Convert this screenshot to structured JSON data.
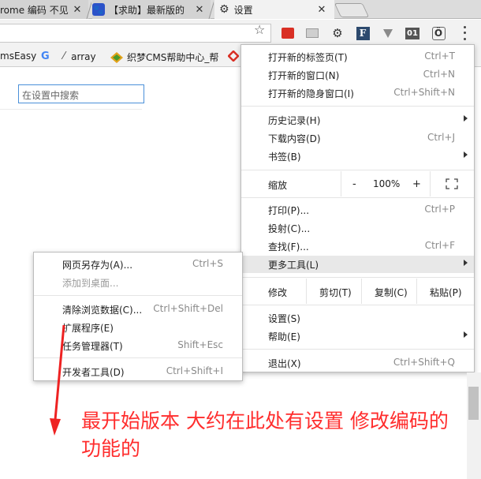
{
  "tabs": [
    {
      "title": "rome 编码 不见",
      "close": "✕"
    },
    {
      "title": "【求助】最新版的",
      "close": "✕"
    },
    {
      "title": "设置",
      "close": "✕"
    }
  ],
  "toolbar": {
    "star_icon": "☆",
    "ext_01": "01",
    "ext_f": "F",
    "ext_o": "Ö"
  },
  "bookmarks": [
    {
      "label": "msEasy"
    },
    {
      "label": "G"
    },
    {
      "label": "array"
    },
    {
      "label": "织梦CMS帮助中心_帮"
    }
  ],
  "search": {
    "placeholder": "在设置中搜索"
  },
  "menu": {
    "new_tab": {
      "label": "打开新的标签页(T)",
      "shortcut": "Ctrl+T"
    },
    "new_window": {
      "label": "打开新的窗口(N)",
      "shortcut": "Ctrl+N"
    },
    "incognito": {
      "label": "打开新的隐身窗口(I)",
      "shortcut": "Ctrl+Shift+N"
    },
    "history": {
      "label": "历史记录(H)"
    },
    "downloads": {
      "label": "下载内容(D)",
      "shortcut": "Ctrl+J"
    },
    "bookmarks": {
      "label": "书签(B)"
    },
    "zoom": {
      "label": "缩放",
      "minus": "-",
      "value": "100%",
      "plus": "+"
    },
    "print": {
      "label": "打印(P)...",
      "shortcut": "Ctrl+P"
    },
    "cast": {
      "label": "投射(C)..."
    },
    "find": {
      "label": "查找(F)...",
      "shortcut": "Ctrl+F"
    },
    "more_tools": {
      "label": "更多工具(L)"
    },
    "edit": {
      "label": "修改",
      "cut": "剪切(T)",
      "copy": "复制(C)",
      "paste": "粘贴(P)"
    },
    "settings": {
      "label": "设置(S)"
    },
    "help": {
      "label": "帮助(E)"
    },
    "exit": {
      "label": "退出(X)",
      "shortcut": "Ctrl+Shift+Q"
    }
  },
  "submenu": {
    "save_as": {
      "label": "网页另存为(A)...",
      "shortcut": "Ctrl+S"
    },
    "add_desktop": {
      "label": "添加到桌面..."
    },
    "clear_data": {
      "label": "清除浏览数据(C)...",
      "shortcut": "Ctrl+Shift+Del"
    },
    "extensions": {
      "label": "扩展程序(E)"
    },
    "task_manager": {
      "label": "任务管理器(T)",
      "shortcut": "Shift+Esc"
    },
    "devtools": {
      "label": "开发者工具(D)",
      "shortcut": "Ctrl+Shift+I"
    }
  },
  "annotation": {
    "text": "最开始版本 大约在此处有设置 修改编码的功能的",
    "color": "#ff2d2d"
  }
}
